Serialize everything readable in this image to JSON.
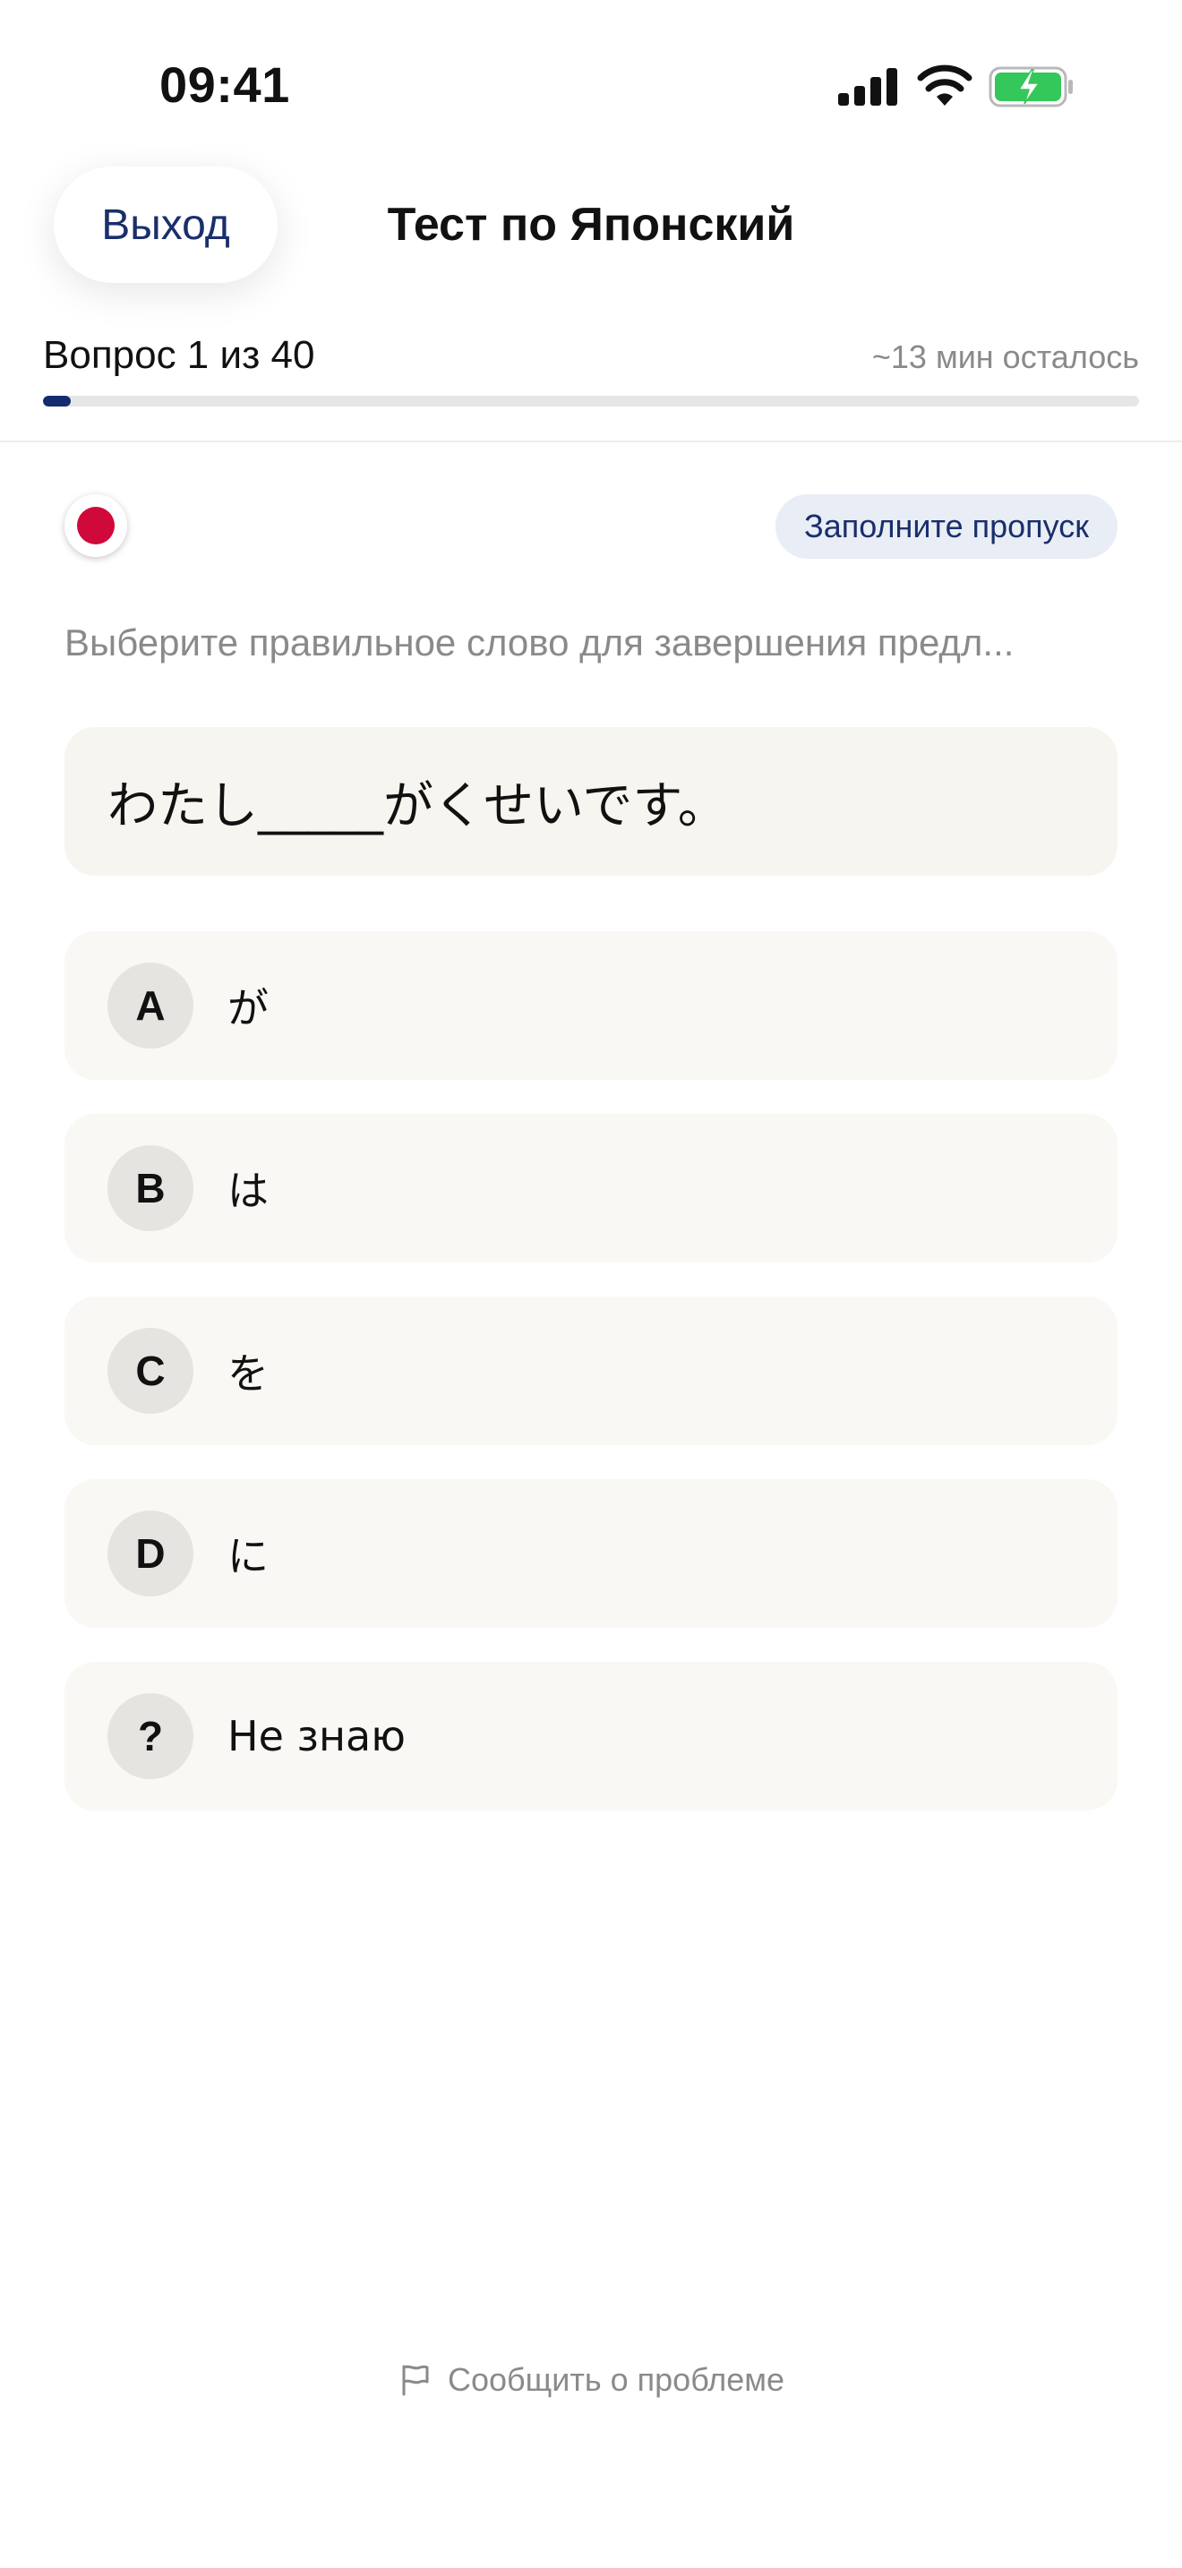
{
  "status_bar": {
    "time": "09:41",
    "icons": [
      "cellular-signal-icon",
      "wifi-icon",
      "battery-charging-icon"
    ],
    "battery_color": "#34c759"
  },
  "header": {
    "exit_label": "Выход",
    "title": "Тест по Японский"
  },
  "progress": {
    "label": "Вопрос 1 из 40",
    "time_left": "~13 мин осталось",
    "fraction": 0.025,
    "fill_color": "#142c6e"
  },
  "question": {
    "flag_icon": "japan-flag-icon",
    "flag_color": "#cf0a3a",
    "type_badge": "Заполните пропуск",
    "instruction": "Выберите правильное слово для завершения предл...",
    "sentence": "わたし_____がくせいです。",
    "options": [
      {
        "key": "A",
        "text": "が"
      },
      {
        "key": "B",
        "text": "は"
      },
      {
        "key": "C",
        "text": "を"
      },
      {
        "key": "D",
        "text": "に"
      },
      {
        "key": "?",
        "text": "Не знаю"
      }
    ]
  },
  "footer": {
    "report_icon": "flag-outline-icon",
    "report_label": "Сообщить о проблеме"
  },
  "colors": {
    "accent": "#1a2f6b",
    "muted_text": "#8a8a8a",
    "card_background": "#f7f5ef"
  }
}
